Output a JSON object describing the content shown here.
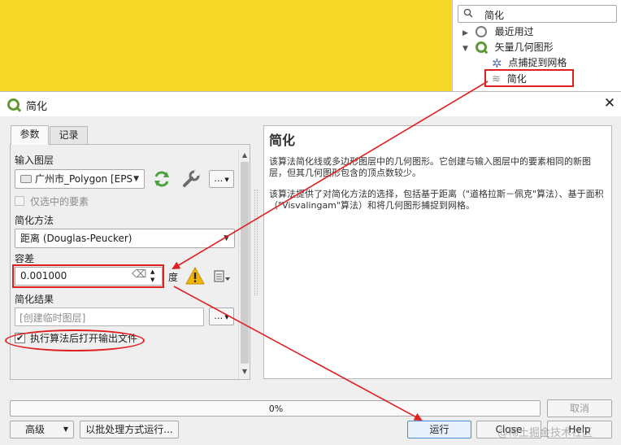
{
  "toolbox": {
    "search_value": "简化",
    "tree": [
      {
        "label": "最近用过",
        "icon": "history-icon",
        "arrow": "▶"
      },
      {
        "label": "矢量几何图形",
        "icon": "qgis-logo-icon",
        "arrow": "▼"
      },
      {
        "label": "点捕捉到网格",
        "icon": "gear-icon",
        "arrow": ""
      },
      {
        "label": "简化",
        "icon": "simplify-icon",
        "arrow": ""
      }
    ]
  },
  "dialog": {
    "title": "简化",
    "tabs": [
      "参数",
      "记录"
    ],
    "params": {
      "input_layer_label": "输入图层",
      "input_layer_value": "广州市_Polygon [EPS",
      "selected_only_label": "仅选中的要素",
      "method_label": "简化方法",
      "method_value": "距离 (Douglas-Peucker)",
      "tolerance_label": "容差",
      "tolerance_value": "0.001000",
      "tolerance_unit": "度",
      "output_label": "简化结果",
      "output_placeholder": "[创建临时图层]",
      "open_output_label": "执行算法后打开输出文件",
      "more_button": "…"
    },
    "help": {
      "title": "简化",
      "p1": "该算法简化线或多边形图层中的几何图形。它创建与输入图层中的要素相同的新图层，但其几何图形包含的顶点数较少。",
      "p2": "该算法提供了对简化方法的选择，包括基于距离（\"道格拉斯－佩克\"算法）、基于面积（\"Visvalingam\"算法）和将几何图形捕捉到网格。"
    },
    "progress": {
      "text": "0%",
      "value": 0
    },
    "buttons": {
      "cancel": "取消",
      "advanced": "高级",
      "batch": "以批处理方式运行...",
      "run": "运行",
      "close": "Close",
      "help": "Help"
    }
  },
  "watermark": "@稀土掘金技术社区",
  "colors": {
    "annotation_red": "#e02020",
    "map_yellow": "#f5d826",
    "qgis_green": "#5f9a35"
  }
}
